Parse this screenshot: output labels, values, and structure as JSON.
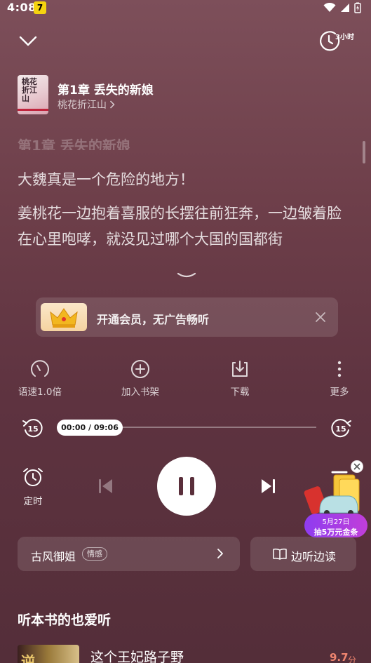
{
  "status_bar": {
    "time": "4:08",
    "app_icon_glyph": "7",
    "icons": [
      "wifi-icon",
      "cellular-icon",
      "battery-charging-icon"
    ]
  },
  "header": {
    "collapse_icon": "chevron-down-icon",
    "timer_label": "3小时",
    "timer_icon": "timer-icon"
  },
  "book": {
    "cover_text": "桃花折江山",
    "chapter_title": "第1章 丢失的新娘",
    "book_title": "桃花折江山"
  },
  "text_preview": {
    "faded_heading": "第1章 丢失的新娘",
    "line1": "大魏真是一个危险的地方！",
    "paragraph": "姜桃花一边抱着喜服的长摆往前狂奔，一边皱着脸在心里咆哮，就没见过哪个大国的国都街"
  },
  "vip_banner": {
    "text": "开通会员，无广告畅听",
    "icon": "crown-icon",
    "close_icon": "close-icon"
  },
  "actions": [
    {
      "label": "语速1.0倍",
      "icon": "speed-gauge-icon"
    },
    {
      "label": "加入书架",
      "icon": "add-circle-icon"
    },
    {
      "label": "下载",
      "icon": "download-icon"
    },
    {
      "label": "更多",
      "icon": "more-vertical-icon"
    }
  ],
  "player": {
    "current_time_display": "00:00 / 09:06",
    "progress": 0,
    "rewind_label": "15",
    "forward_label": "15",
    "alarm_label": "定时"
  },
  "promo": {
    "date": "5月27日",
    "text": "抽5万元金条"
  },
  "tags": {
    "name": "古风御姐",
    "chip": "情感",
    "read_label": "边听边读"
  },
  "recommendations": {
    "section_title": "听本书的也爱听",
    "items": [
      {
        "cover_char": "逆",
        "title": "这个王妃路子野",
        "score": "9.7",
        "score_unit": "分"
      }
    ]
  },
  "colors": {
    "background_top": "#7d4f5a",
    "background_bottom": "#542e39",
    "score": "#f0856f",
    "promo_purple": "#8e3cf0"
  }
}
